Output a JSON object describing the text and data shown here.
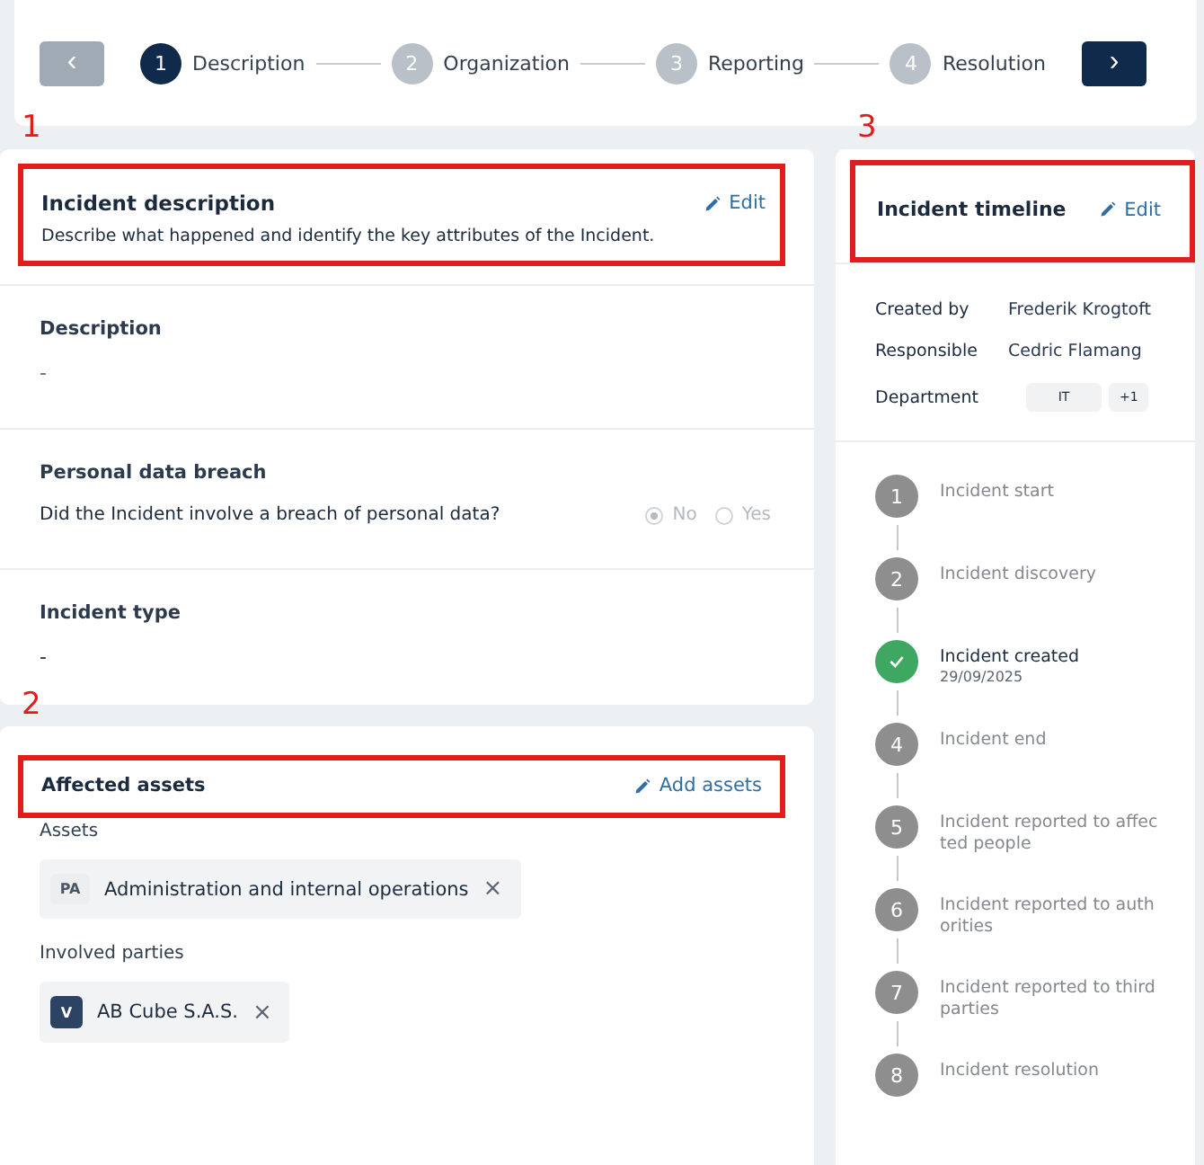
{
  "stepper": {
    "prev": "‹",
    "next": "›",
    "prev_disabled": true,
    "steps": [
      {
        "number": "1",
        "label": "Description",
        "selected": true
      },
      {
        "number": "2",
        "label": "Organization",
        "selected": false
      },
      {
        "number": "3",
        "label": "Reporting",
        "selected": false
      },
      {
        "number": "4",
        "label": "Resolution",
        "selected": false
      }
    ]
  },
  "description_card": {
    "annotation": "1",
    "title": "Incident description",
    "subtitle": "Describe what happened and identify the key attributes of the Incident.",
    "action": "Edit",
    "description": {
      "label": "Description",
      "value": "-"
    },
    "breach": {
      "label": "Personal data breach",
      "question": "Did the Incident involve a breach of personal data?",
      "options": [
        {
          "label": "No",
          "selected": true
        },
        {
          "label": "Yes",
          "selected": false
        }
      ]
    },
    "incident_type": {
      "label": "Incident type",
      "value": "-"
    }
  },
  "assets_card": {
    "annotation": "2",
    "title": "Affected assets",
    "action": "Add assets",
    "assets": {
      "label": "Assets",
      "chips": [
        {
          "badge": "PA",
          "label": "Administration and internal operations",
          "remove": "×",
          "kind": "light"
        }
      ]
    },
    "parties": {
      "label": "Involved parties",
      "chips": [
        {
          "badge": "V",
          "label": "AB Cube S.A.S.",
          "remove": "×",
          "kind": "dark"
        }
      ]
    }
  },
  "timeline_card": {
    "annotation": "3",
    "title": "Incident timeline",
    "action": "Edit",
    "details": [
      {
        "label": "Created by",
        "value": "Frederik Krogtoft"
      },
      {
        "label": "Responsible",
        "value": "Cedric Flamang"
      }
    ],
    "department": {
      "label": "Department",
      "tags": [
        "IT",
        "+1"
      ]
    },
    "events": [
      {
        "number": "1",
        "label": "Incident start",
        "done": false
      },
      {
        "number": "2",
        "label": "Incident discovery",
        "done": false
      },
      {
        "label": "Incident created",
        "date": "29/09/2025",
        "done": true
      },
      {
        "number": "4",
        "label": "Incident end",
        "done": false
      },
      {
        "number": "5",
        "label": "Incident reported to affected people",
        "done": false
      },
      {
        "number": "6",
        "label": "Incident reported to authorities",
        "done": false
      },
      {
        "number": "7",
        "label": "Incident reported to third parties",
        "done": false
      },
      {
        "number": "8",
        "label": "Incident resolution",
        "done": false
      }
    ]
  }
}
